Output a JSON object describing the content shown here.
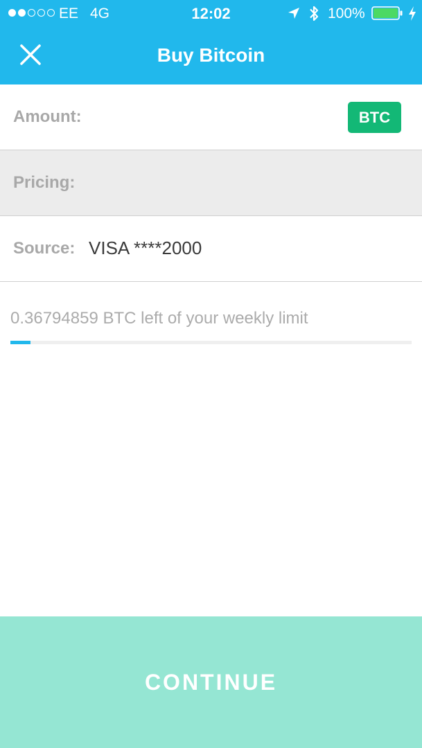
{
  "status_bar": {
    "carrier": "EE",
    "network": "4G",
    "time": "12:02",
    "battery_percent": "100%",
    "signal_bars_filled": 2,
    "signal_bars_total": 5,
    "battery_level": 1.0,
    "icons": [
      "location-arrow-icon",
      "bluetooth-icon",
      "battery-icon",
      "charging-bolt-icon"
    ]
  },
  "nav": {
    "title": "Buy Bitcoin",
    "close_icon": "close-icon"
  },
  "form": {
    "amount_label": "Amount:",
    "amount_value": "",
    "currency_label": "BTC",
    "pricing_label": "Pricing:",
    "source_label": "Source:",
    "source_value": "VISA ****2000"
  },
  "limit": {
    "text": "0.36794859 BTC left of your weekly limit",
    "progress_fraction": 0.05
  },
  "continue_label": "CONTINUE",
  "colors": {
    "header": "#21b8ec",
    "currency_badge": "#13b876",
    "continue_button": "#95e6d3",
    "limit_fill": "#21b8ec"
  }
}
